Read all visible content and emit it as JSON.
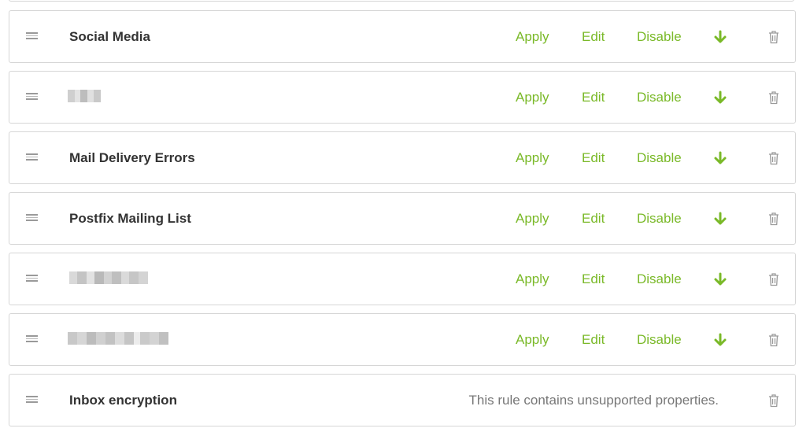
{
  "filter_rules": {
    "actions": {
      "apply": "Apply",
      "edit": "Edit",
      "disable": "Disable"
    },
    "rules": [
      {
        "name": "Social Media",
        "blurred": false
      },
      {
        "name": "",
        "blurred": true
      },
      {
        "name": "Mail Delivery Errors",
        "blurred": false
      },
      {
        "name": "Postfix Mailing List",
        "blurred": false
      },
      {
        "name": "",
        "blurred": true
      },
      {
        "name": "",
        "blurred": true
      },
      {
        "name": "Inbox encryption",
        "blurred": false,
        "status_text": "This rule contains unsupported properties."
      }
    ],
    "icons": {
      "handle": "drag-handle-icon",
      "move_down": "arrow-down-icon",
      "delete": "trash-icon"
    },
    "colors": {
      "action_green": "#7ab928",
      "border": "#d6d6d6",
      "muted_text": "#777777"
    }
  }
}
